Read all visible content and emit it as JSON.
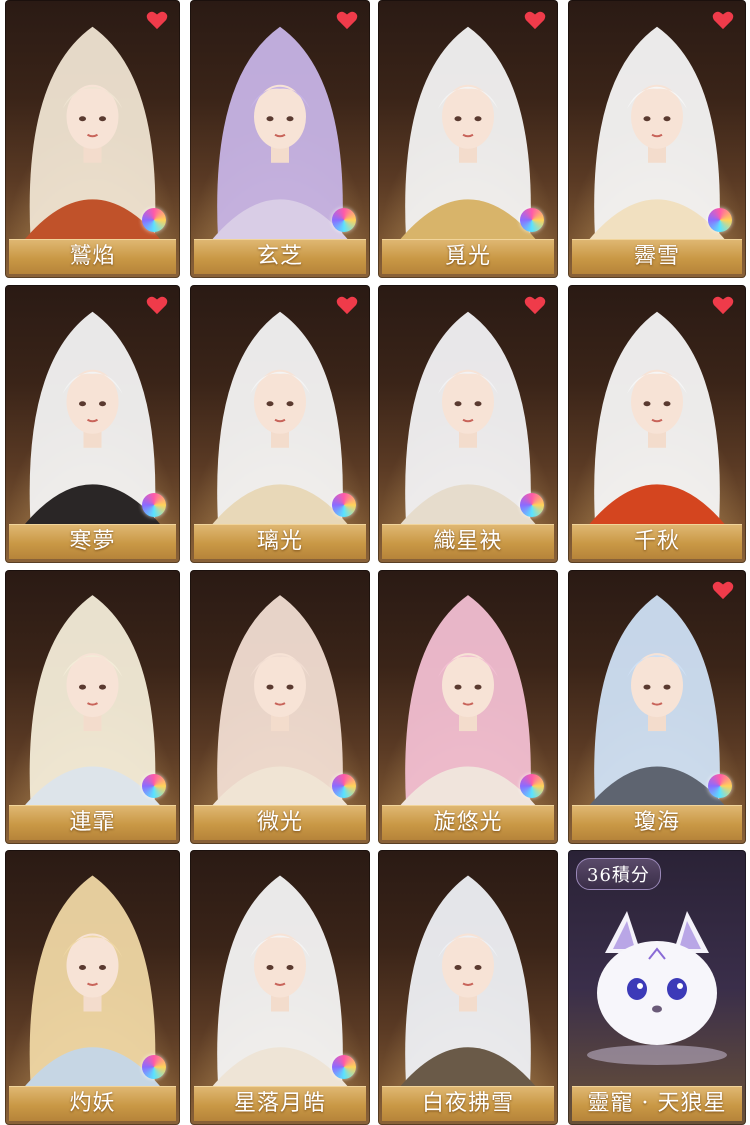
{
  "cards": [
    {
      "name": "鷲焰",
      "hair": "#efe4d2",
      "outfit": "#c0522a",
      "heart": true,
      "orb": true
    },
    {
      "name": "玄芝",
      "hair": "#c7b4e6",
      "outfit": "#d9cde6",
      "heart": true,
      "orb": true
    },
    {
      "name": "覓光",
      "hair": "#f3f3f3",
      "outfit": "#d8b46a",
      "heart": true,
      "orb": true
    },
    {
      "name": "霽雪",
      "hair": "#f6f6f6",
      "outfit": "#f1e0c0",
      "heart": true,
      "orb": true
    },
    {
      "name": "寒夢",
      "hair": "#f3f3f3",
      "outfit": "#2a2626",
      "heart": true,
      "orb": true
    },
    {
      "name": "璃光",
      "hair": "#f4f4f4",
      "outfit": "#e8d8b8",
      "heart": true,
      "orb": true
    },
    {
      "name": "織星袂",
      "hair": "#f2f2f4",
      "outfit": "#e6dccc",
      "heart": true,
      "orb": true
    },
    {
      "name": "千秋",
      "hair": "#f6f6f6",
      "outfit": "#d4451f",
      "heart": true,
      "orb": false
    },
    {
      "name": "連霏",
      "hair": "#f3ecd8",
      "outfit": "#dde4ea",
      "heart": false,
      "orb": true
    },
    {
      "name": "微光",
      "hair": "#f1ddd2",
      "outfit": "#f0e4d4",
      "heart": false,
      "orb": true
    },
    {
      "name": "旋悠光",
      "hair": "#f2bfd2",
      "outfit": "#f0e4dc",
      "heart": false,
      "orb": true
    },
    {
      "name": "瓊海",
      "hair": "#cfe0f4",
      "outfit": "#5e6470",
      "heart": true,
      "orb": true
    },
    {
      "name": "灼妖",
      "hair": "#efd7a4",
      "outfit": "#c6d6e4",
      "heart": false,
      "orb": true
    },
    {
      "name": "星落月皓",
      "hair": "#f4f4f4",
      "outfit": "#eee4d6",
      "heart": false,
      "orb": true
    },
    {
      "name": "白夜拂雪",
      "hair": "#eef0f4",
      "outfit": "#6a5a48",
      "heart": false,
      "orb": false
    }
  ],
  "pet_card": {
    "points_label": "36積分",
    "name": "靈寵 · 天狼星"
  }
}
